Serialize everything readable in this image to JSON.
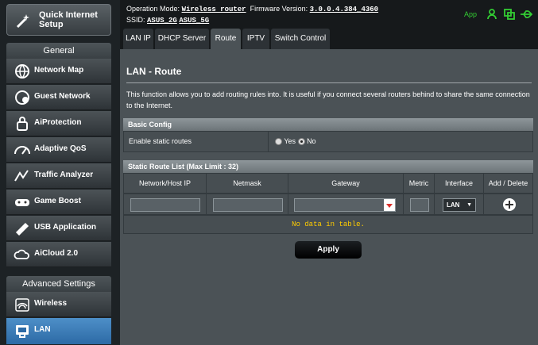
{
  "sidebar": {
    "quick_setup": "Quick Internet Setup",
    "general_header": "General",
    "general_items": [
      {
        "label": "Network Map",
        "icon": "globe-icon"
      },
      {
        "label": "Guest Network",
        "icon": "guest-network-icon"
      },
      {
        "label": "AiProtection",
        "icon": "lock-icon"
      },
      {
        "label": "Adaptive QoS",
        "icon": "speedometer-icon"
      },
      {
        "label": "Traffic Analyzer",
        "icon": "traffic-icon"
      },
      {
        "label": "Game Boost",
        "icon": "gamepad-icon"
      },
      {
        "label": "USB Application",
        "icon": "puzzle-icon"
      },
      {
        "label": "AiCloud 2.0",
        "icon": "cloud-icon"
      }
    ],
    "advanced_header": "Advanced Settings",
    "advanced_items": [
      {
        "label": "Wireless",
        "icon": "wifi-icon"
      },
      {
        "label": "LAN",
        "icon": "lan-icon"
      }
    ]
  },
  "topbar": {
    "operation_mode_label": "Operation Mode:",
    "operation_mode_value": "Wireless router",
    "firmware_label": "Firmware Version:",
    "firmware_value": "3.0.0.4.384_4360",
    "ssid_label": "SSID:",
    "ssid_2g": "ASUS_2G",
    "ssid_5g": "ASUS_5G",
    "app_label": "App"
  },
  "tabs": [
    "LAN IP",
    "DHCP Server",
    "Route",
    "IPTV",
    "Switch Control"
  ],
  "page": {
    "title": "LAN - Route",
    "description": "This function allows you to add routing rules into. It is useful if you connect several routers behind to share the same connection to the Internet.",
    "basic_config_header": "Basic Config",
    "enable_static_label": "Enable static routes",
    "yes_label": "Yes",
    "no_label": "No",
    "static_list_header": "Static Route List (Max Limit : 32)",
    "columns": [
      "Network/Host IP",
      "Netmask",
      "Gateway",
      "Metric",
      "Interface",
      "Add / Delete"
    ],
    "interface_value": "LAN",
    "no_data": "No data in table.",
    "apply_label": "Apply"
  },
  "colors": {
    "accent": "#2d6aa5",
    "empty_text": "#ffcc00",
    "app_green": "#33cc33"
  }
}
